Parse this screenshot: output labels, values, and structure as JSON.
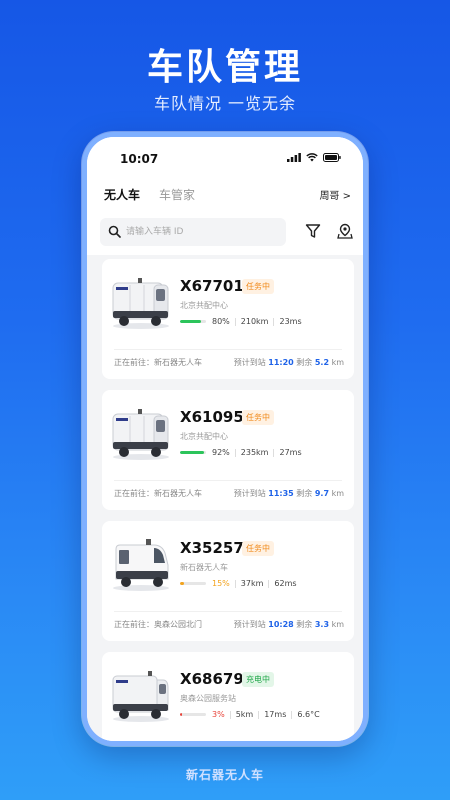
{
  "hero": {
    "title": "车队管理",
    "subtitle": "车队情况  一览无余"
  },
  "status_bar": {
    "time": "10:07"
  },
  "tabs": [
    {
      "label": "无人车",
      "active": true
    },
    {
      "label": "车管家",
      "active": false
    }
  ],
  "user": {
    "name": "周哥 >"
  },
  "search": {
    "placeholder": "请输入车辆 ID"
  },
  "vehicles": [
    {
      "plate": "X67701",
      "status": "任务中",
      "status_color": "orange",
      "location": "北京共配中心",
      "battery": "80%",
      "battery_level": 0.8,
      "battery_color": "#2cc45b",
      "distance": "210km",
      "extra": "23ms",
      "dest_label": "正在前往：新石器无人车",
      "eta_label": "预计到站",
      "eta_time": "11:20",
      "remain_label": "剩余",
      "remain_value": "5.2",
      "remain_unit": "km"
    },
    {
      "plate": "X61095",
      "status": "任务中",
      "status_color": "orange",
      "location": "北京共配中心",
      "battery": "92%",
      "battery_level": 0.92,
      "battery_color": "#2cc45b",
      "distance": "235km",
      "extra": "27ms",
      "dest_label": "正在前往：新石器无人车",
      "eta_label": "预计到站",
      "eta_time": "11:35",
      "remain_label": "剩余",
      "remain_value": "9.7",
      "remain_unit": "km"
    },
    {
      "plate": "X35257",
      "status": "任务中",
      "status_color": "orange",
      "location": "新石器无人车",
      "battery": "15%",
      "battery_level": 0.15,
      "battery_color": "#f2a31e",
      "distance": "37km",
      "extra": "62ms",
      "dest_label": "正在前往：奥森公园北门",
      "eta_label": "预计到站",
      "eta_time": "10:28",
      "remain_label": "剩余",
      "remain_value": "3.3",
      "remain_unit": "km"
    },
    {
      "plate": "X68679",
      "status": "充电中",
      "status_color": "green",
      "location": "奥森公园服务站",
      "battery": "3%",
      "battery_level": 0.03,
      "battery_color": "#e8443a",
      "distance": "5km",
      "extra": "17ms",
      "temp": "6.6°C"
    }
  ],
  "footer": {
    "brand": "新石器无人车"
  },
  "colors": {
    "accent": "#1f63e8",
    "background_top": "#1657e6",
    "background_bottom": "#2f9ef8"
  },
  "icons": [
    "search-icon",
    "filter-icon",
    "map-pin-icon",
    "signal-icon",
    "wifi-icon",
    "battery-icon"
  ]
}
